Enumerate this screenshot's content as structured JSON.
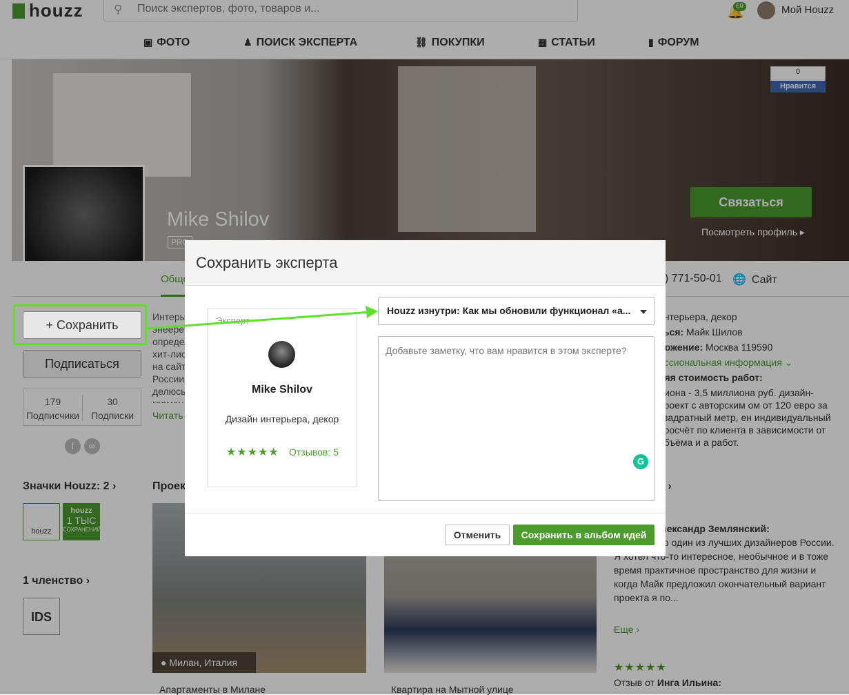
{
  "header": {
    "logo": "houzz",
    "search_placeholder": "Поиск экспертов, фото, товаров и...",
    "notifications_count": "69",
    "account_label": "Мой Houzz"
  },
  "nav": {
    "items": [
      {
        "label": "ФОТО",
        "icon": "photo-icon"
      },
      {
        "label": "ПОИСК ЭКСПЕРТА",
        "icon": "expert-icon"
      },
      {
        "label": "ПОКУПКИ",
        "icon": "cart-icon"
      },
      {
        "label": "СТАТЬИ",
        "icon": "book-icon"
      },
      {
        "label": "ФОРУМ",
        "icon": "chat-icon"
      }
    ]
  },
  "profile": {
    "name": "Mike Shilov",
    "pro_badge": "PRO",
    "contact_button": "Связаться",
    "view_profile": "Посмотреть профиль ▸",
    "fb_count": "0",
    "fb_like": "Нравится",
    "tab_general": "Обще",
    "phone": "5) 771-50-01",
    "site": "Сайт",
    "save_button": "+ Сохранить",
    "subscribe_button": "Подписаться",
    "followers_count": "179",
    "followers_label": "Подписчики",
    "following_count": "30",
    "following_label": "Подписки",
    "bio": "Интерь энеере определ хит-лис на сайт России делюсь гармон",
    "read_more": "Читать",
    "info": {
      "line1": "интерьера, декор",
      "line2_label": "ться:",
      "line2_value": "Майк Шилов",
      "line3_label": "ложение:",
      "line3_value": "Москва 119590",
      "pro_info": "ессиональная информация",
      "cost_label": "няя стоимость работ:",
      "cost_text": "лиона - 3,5 миллиона руб. дизайн-проект с авторским ом от 120 евро за квадратный метр, ен индивидуальный просчёт по клиента в зависимости от объёма и а работ."
    }
  },
  "badges": {
    "title": "Значки Houzz: 2 ›",
    "badge1": "houzz",
    "badge2_brand": "houzz",
    "badge2_value": "1 ТЫС",
    "badge2_label": "СОХРАНЕНИЙ"
  },
  "membership": {
    "title": "1 членство ›",
    "ids": "IDS"
  },
  "projects": {
    "title": "Проек",
    "items": [
      {
        "caption": "Милан, Италия",
        "name": "Апартаменты в Милане"
      },
      {
        "caption": "",
        "name": "Квартира на Мытной улице"
      }
    ]
  },
  "reviews": {
    "title": "5 ›",
    "review1_stars": "★",
    "review1_author": "лександр Землянский:",
    "review1_text": "ему мнению один из лучших дизайнеров России. Я хотел что-то интересное, необычное и в тоже время практичное пространство для жизни и когда Майк предложил окончательный вариант проекта я по...",
    "more": "Еще ›",
    "review2_stars": "★★★★★",
    "review2_prefix": "Отзыв от",
    "review2_author": "Инга Ильина:"
  },
  "modal": {
    "title": "Сохранить эксперта",
    "card_label": "Эксперт",
    "card_name": "Mike Shilov",
    "card_role": "Дизайн интерьера, декор",
    "card_stars": "★★★★★",
    "card_reviews": "Отзывов: 5",
    "album_value": "Houzz изнутри: Как мы обновили функционал «а...",
    "note_placeholder": "Добавьте заметку, что вам нравится в этом эксперте?",
    "cancel": "Отменить",
    "save": "Сохранить в альбом идей"
  },
  "colors": {
    "brand": "#4b9b2d",
    "highlight": "#5ee02c"
  }
}
